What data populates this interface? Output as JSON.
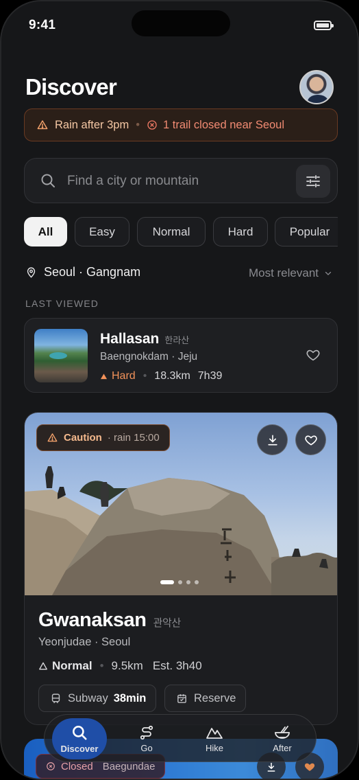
{
  "status": {
    "time": "9:41"
  },
  "header": {
    "title": "Discover"
  },
  "alert": {
    "weather": "Rain after 3pm",
    "trail": "1 trail closed near Seoul"
  },
  "search": {
    "placeholder": "Find a city or mountain"
  },
  "filters": [
    {
      "label": "All",
      "active": true
    },
    {
      "label": "Easy"
    },
    {
      "label": "Normal"
    },
    {
      "label": "Hard"
    },
    {
      "label": "Popular"
    }
  ],
  "location": {
    "name": "Seoul · Gangnam",
    "sort": "Most relevant"
  },
  "last_viewed": {
    "section_label": "LAST VIEWED",
    "name": "Hallasan",
    "korean": "한라산",
    "subtitle": "Baengnokdam · Jeju",
    "difficulty": "Hard",
    "distance": "18.3km",
    "duration": "7h39",
    "difficulty_color": "#f2925a"
  },
  "featured": {
    "badge": "Caution",
    "badge_detail": "· rain 15:00",
    "name": "Gwanaksan",
    "korean": "관악산",
    "subtitle": "Yeonjudae · Seoul",
    "difficulty": "Normal",
    "distance": "9.5km",
    "estimate": "Est. 3h40",
    "transit_label": "Subway",
    "transit_time": "38min",
    "reserve_label": "Reserve",
    "photo_count": 4,
    "photo_index": 1
  },
  "next_card": {
    "badge": "Closed",
    "name": "Baegundae"
  },
  "tabs": [
    {
      "label": "Discover",
      "icon": "search-icon",
      "active": true
    },
    {
      "label": "Go",
      "icon": "route-icon"
    },
    {
      "label": "Hike",
      "icon": "mountain-icon"
    },
    {
      "label": "After",
      "icon": "bowl-icon"
    }
  ],
  "colors": {
    "accent": "#1f4ea7",
    "warning": "#f4b98d",
    "danger": "#f28b73",
    "background": "#161719"
  }
}
